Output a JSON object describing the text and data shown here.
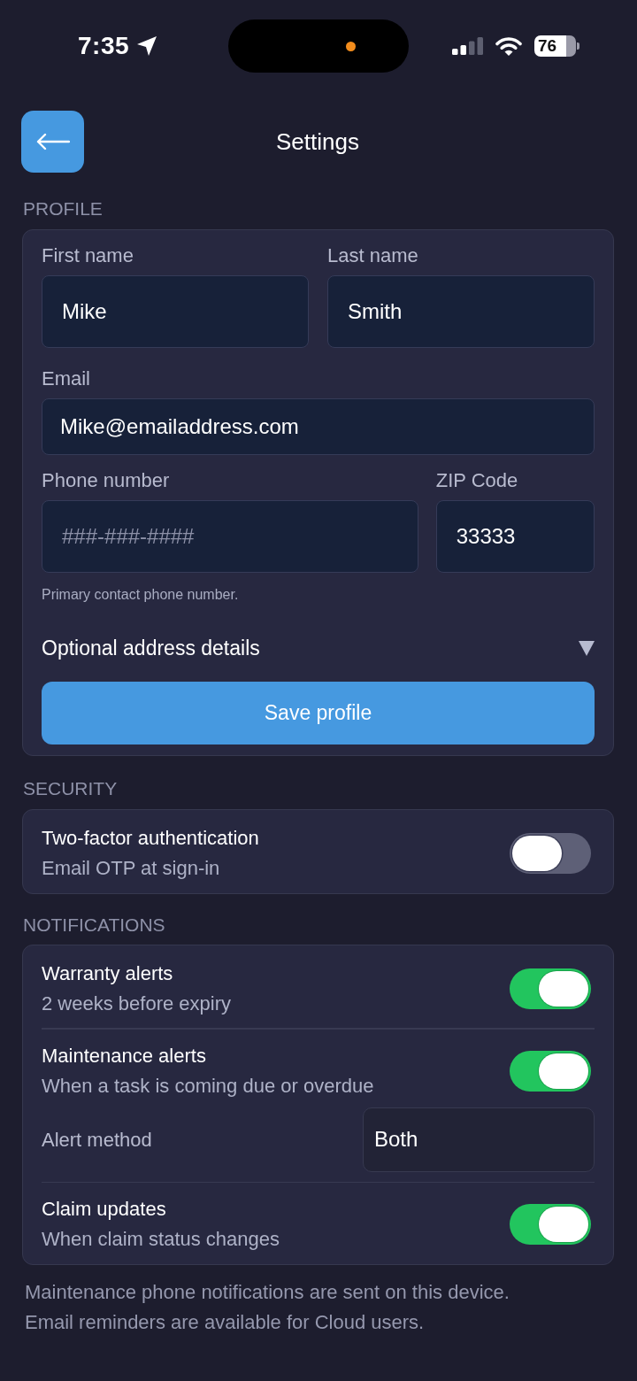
{
  "status_bar": {
    "time": "7:35",
    "battery": "76"
  },
  "header": {
    "title": "Settings"
  },
  "profile": {
    "heading": "PROFILE",
    "field_rows": [
      [
        {
          "label": "First name",
          "value": "Mike"
        },
        {
          "label": "Last name",
          "value": "Smith"
        }
      ],
      [
        {
          "label": "Email",
          "value": "Mike@emailaddress.com"
        }
      ],
      [
        {
          "label": "Phone number",
          "placeholder": "###-###-####"
        },
        {
          "label": "ZIP Code",
          "value": "33333"
        }
      ]
    ],
    "helper": "Primary contact phone number.",
    "disclosure": {
      "label": "Optional address details",
      "expanded": false
    },
    "save_button": "Save profile"
  },
  "security": {
    "heading": "SECURITY",
    "items": [
      {
        "kind": "toggle",
        "title": "Two-factor authentication",
        "subtitle": "Email OTP at sign-in",
        "on": false
      }
    ]
  },
  "notifications": {
    "heading": "NOTIFICATIONS",
    "items": [
      {
        "kind": "toggle",
        "title": "Warranty alerts",
        "subtitle": "2 weeks before expiry",
        "on": true
      },
      {
        "kind": "toggle",
        "title": "Maintenance alerts",
        "subtitle": "When a task is coming due or overdue",
        "on": true
      },
      {
        "kind": "select",
        "label": "Alert method",
        "value": "Both"
      },
      {
        "kind": "toggle",
        "title": "Claim updates",
        "subtitle": "When claim status changes",
        "on": true
      }
    ]
  },
  "footnote": [
    "Maintenance phone notifications are sent on this device.",
    "Email reminders are available for Cloud users."
  ]
}
